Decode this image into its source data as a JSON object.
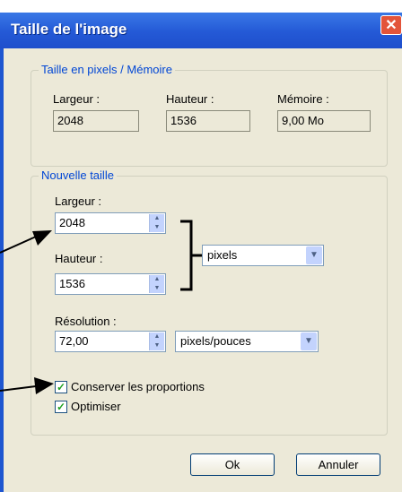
{
  "dialog": {
    "title": "Taille de l'image",
    "close_symbol": "✕",
    "pixel_size_group": {
      "legend": "Taille en pixels / Mémoire",
      "width_label": "Largeur :",
      "width_value": "2048",
      "height_label": "Hauteur :",
      "height_value": "1536",
      "memory_label": "Mémoire :",
      "memory_value": "9,00 Mo"
    },
    "new_size_group": {
      "legend": "Nouvelle taille",
      "width_label": "Largeur :",
      "width_value": "2048",
      "height_label": "Hauteur :",
      "height_value": "1536",
      "unit_selected": "pixels",
      "resolution_label": "Résolution :",
      "resolution_value": "72,00",
      "resolution_unit_selected": "pixels/pouces"
    },
    "options": {
      "keep_proportions_label": "Conserver les proportions",
      "keep_proportions_checked": true,
      "optimize_label": "Optimiser",
      "optimize_checked": true,
      "check_mark": "✓"
    },
    "buttons": {
      "ok_label": "Ok",
      "cancel_label": "Annuler"
    }
  },
  "icons": {
    "spin_up": "▲",
    "spin_down": "▼",
    "dropdown": "▼"
  },
  "colors": {
    "title_bar": "#2459d6",
    "group_legend": "#0046d5",
    "dialog_bg": "#ece9d8",
    "close_button": "#e3543a"
  }
}
